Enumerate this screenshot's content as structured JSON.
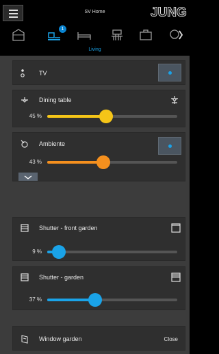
{
  "header": {
    "title": "SV Home",
    "brand": "JUNG"
  },
  "nav": {
    "badge_count": "1",
    "icons": [
      "home-icon",
      "lamp-group-icon",
      "bed-icon",
      "dining-icon",
      "briefcase-icon",
      "bell-icon"
    ],
    "room_label": "Living"
  },
  "cards": {
    "tv": {
      "title": "TV",
      "state": "on"
    },
    "dining": {
      "title": "Dining table",
      "value": "45 %",
      "level": 0.45,
      "color": "#f5c518"
    },
    "ambiente": {
      "title": "Ambiente",
      "value": "43 %",
      "level": 0.43,
      "color": "#f5901e"
    },
    "shutter_front": {
      "title": "Shutter - front garden",
      "value": "9 %",
      "level": 0.09,
      "color": "#1aa3e8"
    },
    "shutter_garden": {
      "title": "Shutter - garden",
      "value": "37 %",
      "level": 0.37,
      "color": "#1aa3e8"
    },
    "window": {
      "title": "Window garden",
      "status": "Close"
    }
  },
  "colors": {
    "accent": "#1aa3e8",
    "background": "#3c3c3c",
    "card": "#2f2f2f"
  }
}
